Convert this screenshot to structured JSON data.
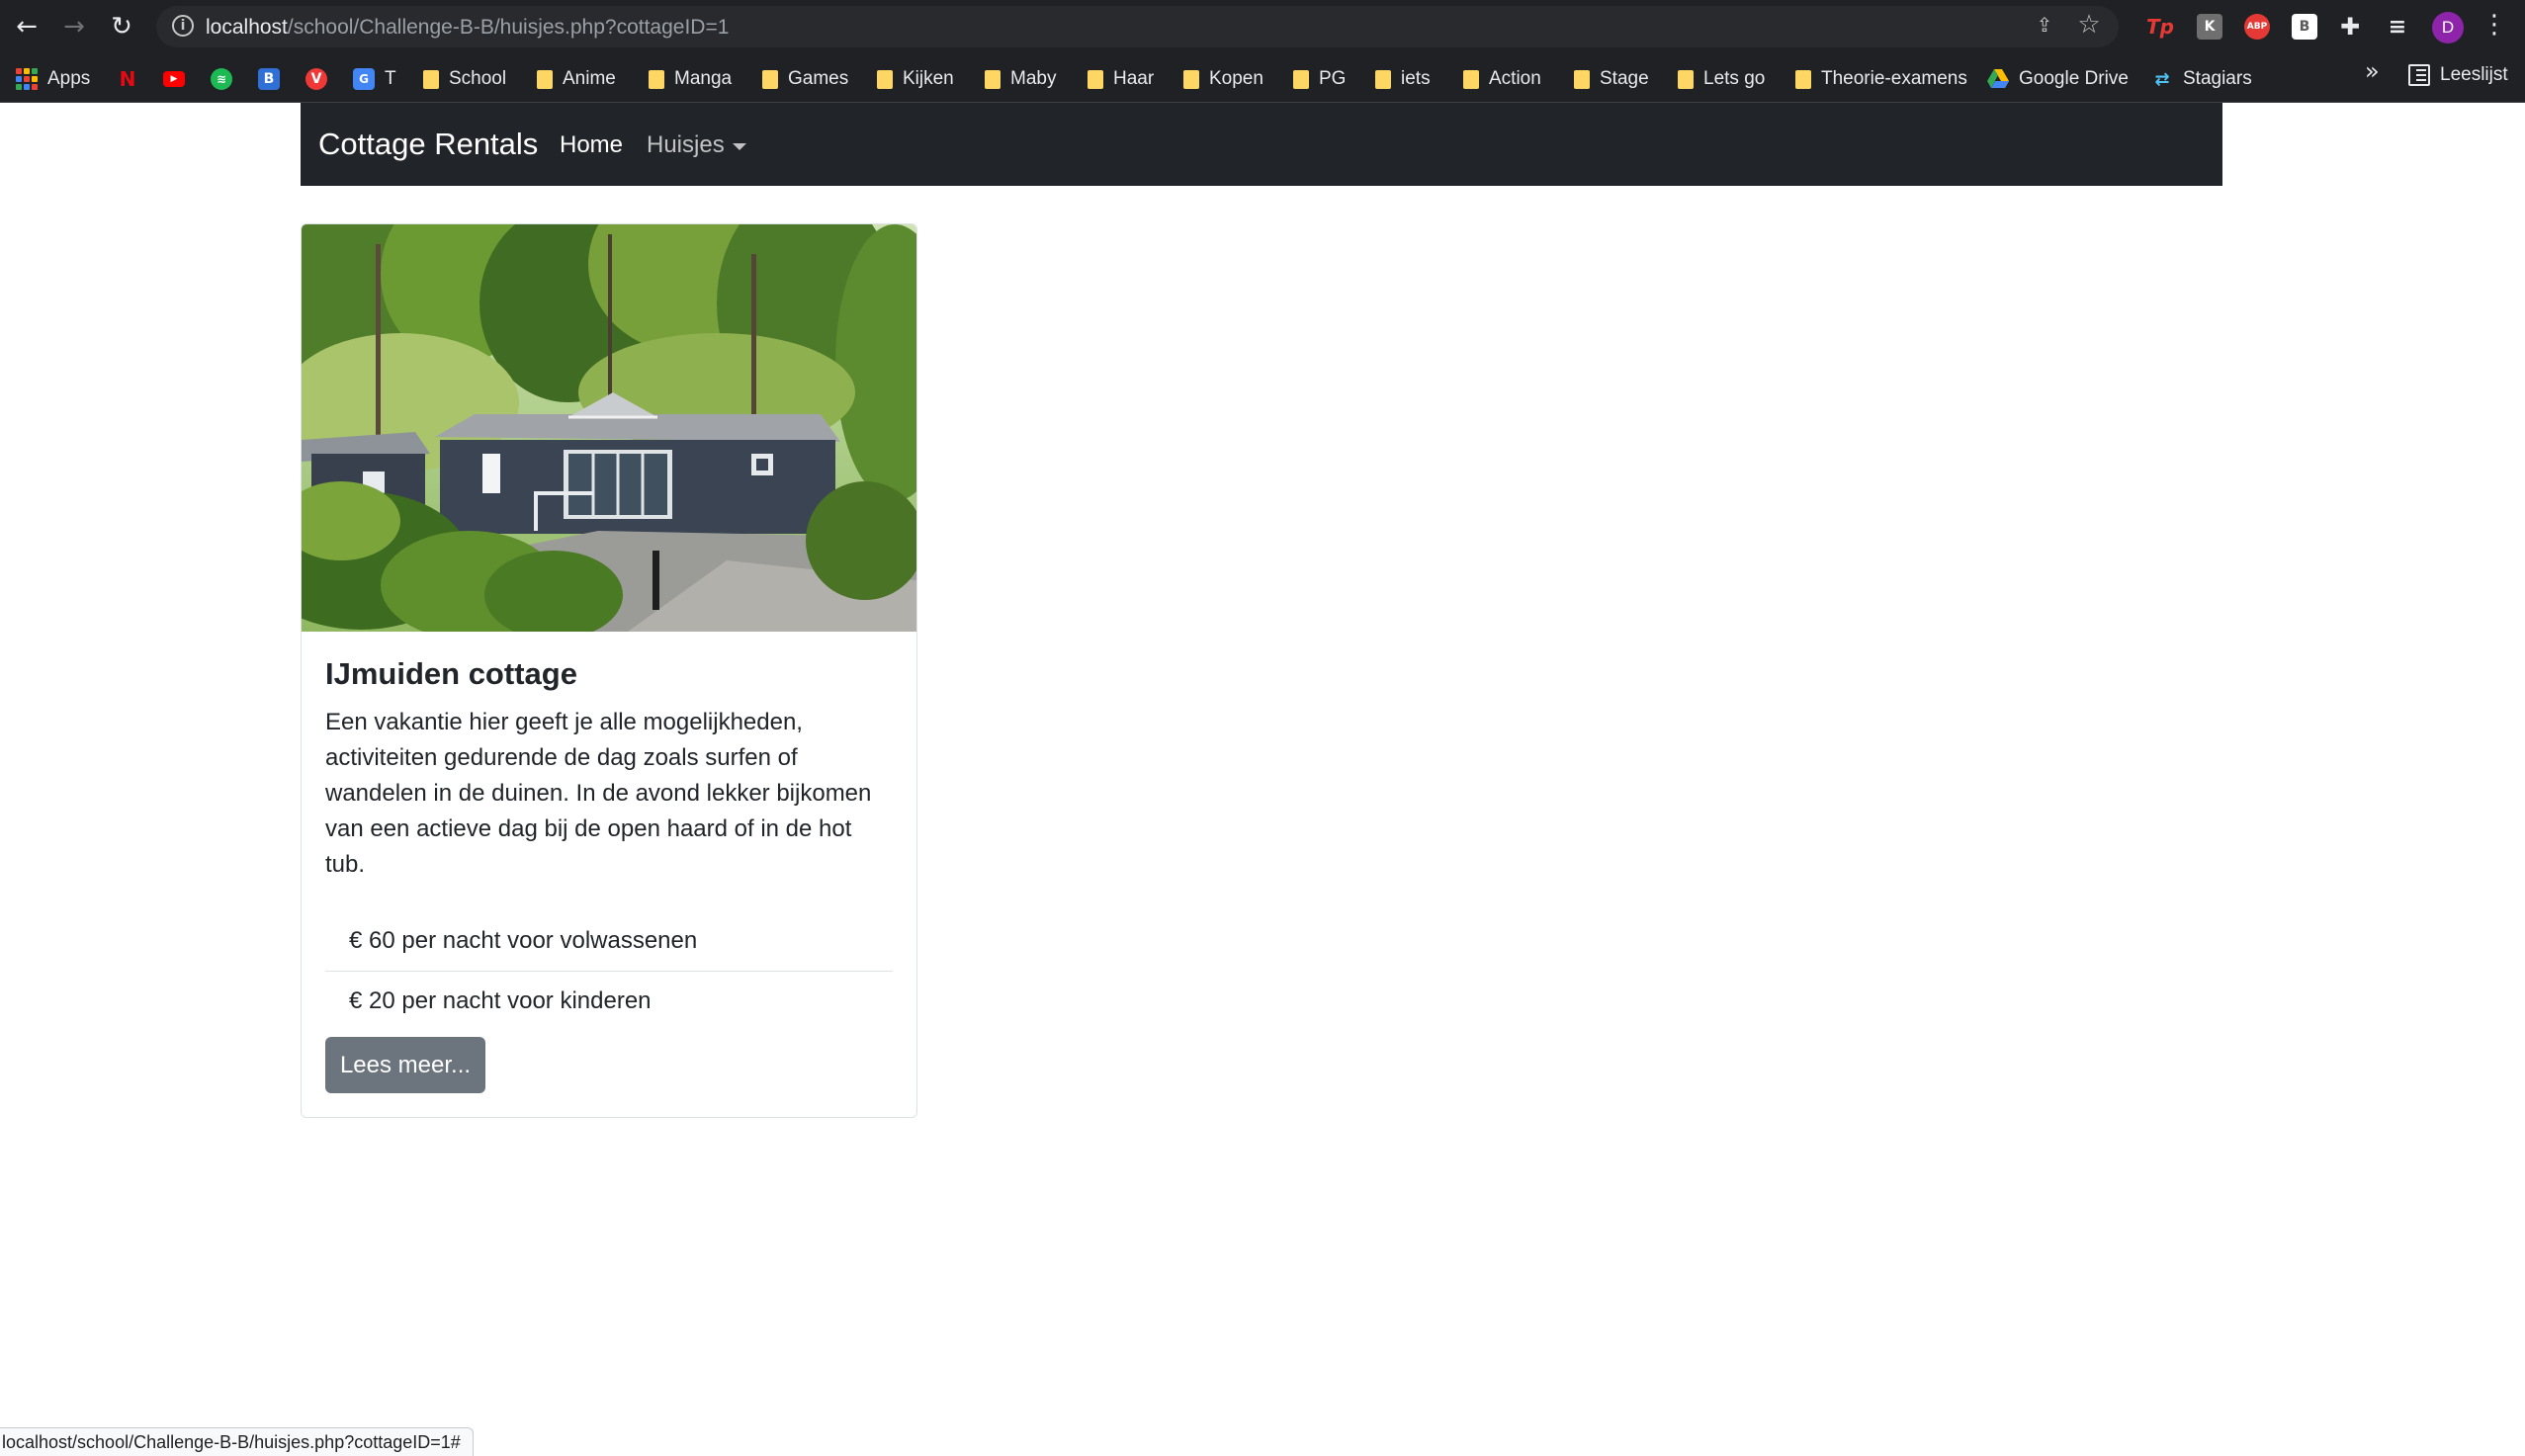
{
  "browser": {
    "url_host": "localhost",
    "url_path": "/school/Challenge-B-B/huisjes.php?cottageID=1",
    "avatar_letter": "D",
    "extensions": {
      "tp": "Tp",
      "k": "K",
      "abp": "ABP",
      "b": "B"
    },
    "bookmarks": {
      "apps": "Apps",
      "t": "T",
      "folders": [
        "School",
        "Anime",
        "Manga",
        "Games",
        "Kijken",
        "Maby",
        "Haar",
        "Kopen",
        "PG",
        "iets",
        "Action",
        "Stage",
        "Lets go",
        "Theorie-examens"
      ],
      "google_drive": "Google Drive",
      "stagiars": "Stagiars",
      "reading_list": "Leeslijst"
    },
    "status_url": "localhost/school/Challenge-B-B/huisjes.php?cottageID=1#"
  },
  "navbar": {
    "brand": "Cottage Rentals",
    "home": "Home",
    "huisjes": "Huisjes"
  },
  "cottage": {
    "title": "IJmuiden cottage",
    "description": "Een vakantie hier geeft je alle mogelijkheden, activiteiten gedurende de dag zoals surfen of wandelen in de duinen. In de avond lekker bijkomen van een actieve dag bij de open haard of in de hot tub.",
    "price_adults": "€ 60 per nacht voor volwassenen",
    "price_children": "€ 20 per nacht voor kinderen",
    "button": "Lees meer..."
  }
}
